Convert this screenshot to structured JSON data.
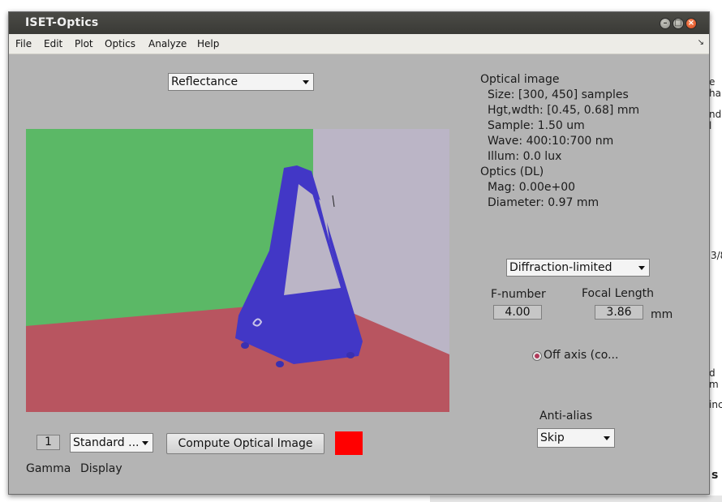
{
  "window": {
    "title": "ISET-Optics"
  },
  "menu": {
    "items": [
      "File",
      "Edit",
      "Plot",
      "Optics",
      "Analyze",
      "Help"
    ],
    "corner": "↘"
  },
  "display_select": {
    "value": "Reflectance"
  },
  "optical_image": {
    "header": "Optical image",
    "size": "Size:  [300, 450] samples",
    "hgt_wdth": "Hgt,wdth: [0.45, 0.68] mm",
    "sample": "Sample: 1.50 um",
    "wave": "Wave: 400:10:700 nm",
    "illum": "Illum:   0.0 lux"
  },
  "optics_info": {
    "header": "Optics (DL)",
    "mag": "Mag:  0.00e+00",
    "diameter": "Diameter:  0.97 mm"
  },
  "optics_model": {
    "value": "Diffraction-limited"
  },
  "fnumber": {
    "label": "F-number",
    "value": "4.00"
  },
  "focal_length": {
    "label": "Focal Length",
    "value": "3.86",
    "unit": "mm"
  },
  "off_axis": {
    "label": "Off axis (co...",
    "selected": true
  },
  "anti_alias": {
    "label": "Anti-alias",
    "value": "Skip"
  },
  "gamma": {
    "value": "1",
    "label": "Gamma"
  },
  "display_mode": {
    "value": "Standard ...",
    "label": "Display"
  },
  "compute_button": {
    "label": "Compute Optical Image"
  },
  "colors": {
    "titlebar": "#3f3f3b",
    "window_bg": "#b4b4b4",
    "status_swatch": "#ff0000",
    "wall_left": "#5bb866",
    "wall_right": "#bbb5c6",
    "floor": "#b85560",
    "metronome": "#4237c6"
  },
  "background_fragments": [
    "e ha",
    "nd l",
    "3/8",
    "d m",
    "inc",
    "s"
  ]
}
